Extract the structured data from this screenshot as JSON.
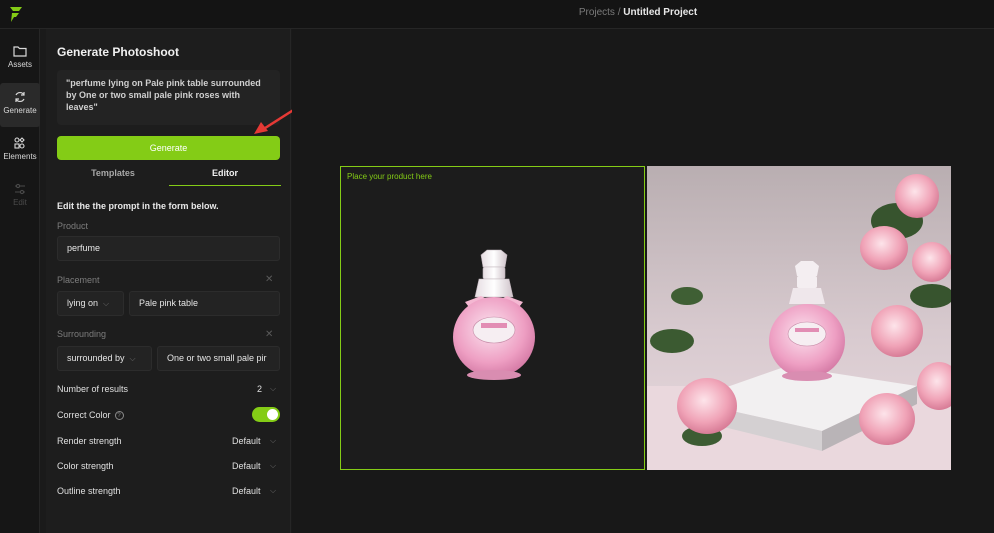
{
  "app": {
    "logo_icon": "lightning-logo-icon",
    "accent_color": "#84cc16"
  },
  "breadcrumb": {
    "parent": "Projects",
    "separator": " / ",
    "current": "Untitled Project"
  },
  "rail": {
    "items": [
      {
        "label": "Assets",
        "icon": "folder-icon"
      },
      {
        "label": "Generate",
        "icon": "refresh-icon"
      },
      {
        "label": "Elements",
        "icon": "elements-grid-icon"
      },
      {
        "label": "Edit",
        "icon": "sliders-icon"
      }
    ]
  },
  "panel": {
    "title": "Generate Photoshoot",
    "prompt": "\"perfume lying on Pale pink table surrounded by One or two small pale pink roses with leaves\"",
    "generate_label": "Generate",
    "tabs": [
      {
        "label": "Templates"
      },
      {
        "label": "Editor"
      }
    ],
    "editor_title": "Edit the the prompt in the form below.",
    "product": {
      "label": "Product",
      "value": "perfume"
    },
    "placement": {
      "label": "Placement",
      "preposition": "lying on",
      "value": "Pale pink table"
    },
    "surrounding": {
      "label": "Surrounding",
      "preposition": "surrounded by",
      "value": "One or two small pale pir"
    },
    "number_of_results": {
      "label": "Number of results",
      "value": "2"
    },
    "correct_color": {
      "label": "Correct Color",
      "enabled": true
    },
    "render_strength": {
      "label": "Render strength",
      "value": "Default"
    },
    "color_strength": {
      "label": "Color strength",
      "value": "Default"
    },
    "outline_strength": {
      "label": "Outline strength",
      "value": "Default"
    }
  },
  "canvas": {
    "drop_label": "Place your product here"
  }
}
